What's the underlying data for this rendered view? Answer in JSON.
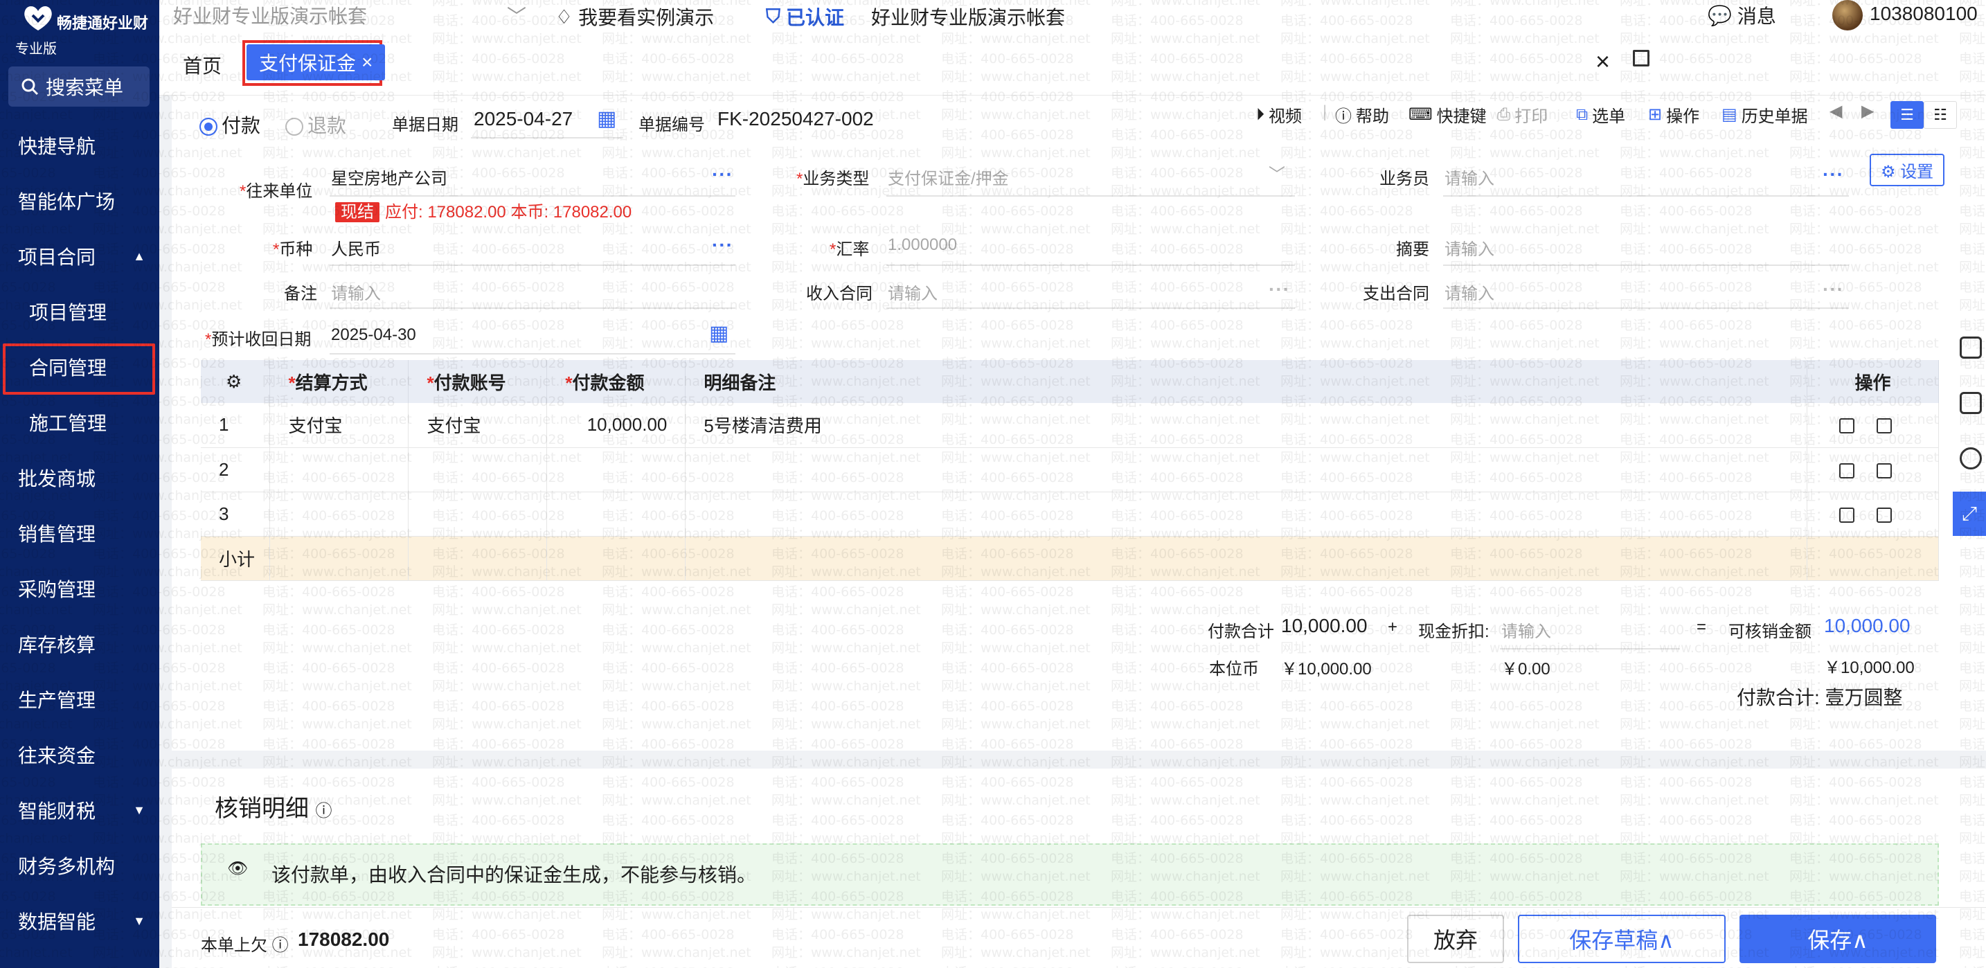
{
  "sidebar": {
    "brand": "畅捷通好业财",
    "edition": "专业版",
    "search": "搜索菜单",
    "items": [
      {
        "label": "快捷导航"
      },
      {
        "label": "智能体广场"
      },
      {
        "label": "项目合同",
        "caret": "▲"
      },
      {
        "label": "项目管理"
      },
      {
        "label": "合同管理"
      },
      {
        "label": "施工管理"
      },
      {
        "label": "批发商城"
      },
      {
        "label": "销售管理"
      },
      {
        "label": "采购管理"
      },
      {
        "label": "库存核算"
      },
      {
        "label": "生产管理"
      },
      {
        "label": "往来资金"
      },
      {
        "label": "智能财税",
        "caret": "▼"
      },
      {
        "label": "财务多机构"
      },
      {
        "label": "数据智能",
        "caret": "▼"
      }
    ]
  },
  "topbar": {
    "account": "好业财专业版演示帐套",
    "demo": "我要看实例演示",
    "certified": "已认证",
    "account2": "好业财专业版演示帐套",
    "messages": "消息",
    "user": "1038080100"
  },
  "tabs": {
    "home": "首页",
    "active": "支付保证金",
    "active_close": "×",
    "close": "×"
  },
  "doc": {
    "pay": "付款",
    "refund": "退款",
    "date_label": "单据日期",
    "date": "2025-04-27",
    "no_label": "单据编号",
    "no": "FK-20250427-002",
    "tools": [
      "视频",
      "帮助",
      "快捷键",
      "打印",
      "选单",
      "操作",
      "历史单据"
    ],
    "settings": "设置"
  },
  "form": {
    "partner_label": "往来单位",
    "partner": "星空房地产公司",
    "cash_badge": "现结",
    "payable": "应付: 178082.00  本币: 178082.00",
    "biz_type_label": "业务类型",
    "biz_type": "支付保证金/押金",
    "salesman_label": "业务员",
    "salesman_ph": "请输入",
    "currency_label": "币种",
    "currency": "人民币",
    "rate_label": "汇率",
    "rate": "1.000000",
    "summary_label": "摘要",
    "summary_ph": "请输入",
    "remark_label": "备注",
    "remark_ph": "请输入",
    "income_label": "收入合同",
    "income_ph": "请输入",
    "expense_label": "支出合同",
    "expense_ph": "请输入",
    "due_label": "预计收回日期",
    "due": "2025-04-30",
    "dots": "···"
  },
  "table": {
    "headers": [
      "结算方式",
      "付款账号",
      "付款金额",
      "明细备注",
      "操作"
    ],
    "rows": [
      {
        "no": "1",
        "method": "支付宝",
        "account": "支付宝",
        "amount": "10,000.00",
        "note": "5号楼清洁费用"
      },
      {
        "no": "2",
        "method": "",
        "account": "",
        "amount": "",
        "note": ""
      },
      {
        "no": "3",
        "method": "",
        "account": "",
        "amount": "",
        "note": ""
      }
    ],
    "subtotal": "小计"
  },
  "totals": {
    "pay_label": "付款合计",
    "pay": "10,000.00",
    "plus": "+",
    "discount_label": "现金折扣:",
    "discount_ph": "请输入",
    "eq": "=",
    "writeoff_label": "可核销金额",
    "writeoff": "10,000.00",
    "base_label": "本位币",
    "base_pay": "￥10,000.00",
    "base_discount": "￥0.00",
    "base_writeoff": "￥10,000.00",
    "caps": "付款合计: 壹万圆整"
  },
  "writeoff": {
    "title": "核销明细",
    "notice": "该付款单，由收入合同中的保证金生成，不能参与核销。"
  },
  "bottom": {
    "prev_label": "本单上欠",
    "prev": "178082.00",
    "discard": "放弃",
    "draft": "保存草稿∧",
    "save": "保存∧"
  },
  "colors": {
    "sidebar": "#0a2467",
    "accent": "#3d6df2",
    "required": "#e8302a"
  }
}
